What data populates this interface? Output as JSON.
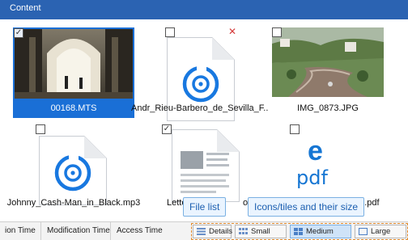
{
  "header": {
    "title": "Content"
  },
  "tiles": [
    {
      "label": "00168.MTS",
      "checked": true,
      "selected": true
    },
    {
      "label": "Andr_Rieu-Barbero_de_Sevilla_F...",
      "checked": false,
      "selected": false,
      "close": "✕"
    },
    {
      "label": "IMG_0873.JPG",
      "checked": false,
      "selected": false
    },
    {
      "label": "Johnny_Cash-Man_in_Black.mp3",
      "checked": false,
      "selected": false
    },
    {
      "label_left": "Lette",
      "label_right": "oc",
      "checked": true,
      "selected": false
    },
    {
      "label_right": "de.pdf",
      "checked": false,
      "selected": false,
      "pdf_text": "pdf",
      "edge_letter": "e"
    }
  ],
  "status": {
    "columns": [
      "ion Time",
      "Modification Time",
      "Access Time"
    ],
    "views": [
      "Details",
      "Small icons",
      "Medium icons",
      "Large icons"
    ],
    "active_view": "Medium icons"
  },
  "callouts": {
    "file_list": "File list",
    "icons_size": "Icons/tiles and their size"
  },
  "colors": {
    "accent": "#2b63b2",
    "selection": "#1a6fd6",
    "callout_text": "#1c5fb0",
    "highlight_frame": "#e08a2e"
  }
}
